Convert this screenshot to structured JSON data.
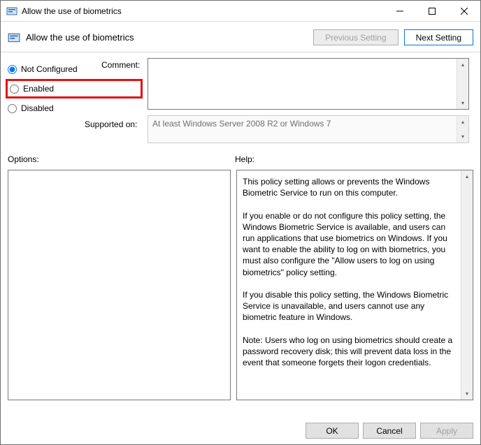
{
  "window": {
    "title": "Allow the use of biometrics"
  },
  "header": {
    "title": "Allow the use of biometrics",
    "prev_label": "Previous Setting",
    "next_label": "Next Setting"
  },
  "state": {
    "not_configured_label": "Not Configured",
    "enabled_label": "Enabled",
    "disabled_label": "Disabled",
    "selected": "not_configured"
  },
  "comment": {
    "label": "Comment:",
    "value": ""
  },
  "supported": {
    "label": "Supported on:",
    "value": "At least Windows Server 2008 R2 or Windows 7"
  },
  "lower": {
    "options_label": "Options:",
    "help_label": "Help:"
  },
  "help": {
    "text": "This policy setting allows or prevents the Windows Biometric Service to run on this computer.\n\nIf you enable or do not configure this policy setting, the Windows Biometric Service is available, and users can run applications that use biometrics on Windows. If you want to enable the ability to log on with biometrics, you must also configure the \"Allow users to log on using biometrics\" policy setting.\n\nIf you disable this policy setting, the Windows Biometric Service is unavailable, and users cannot use any biometric feature in Windows.\n\nNote: Users who log on using biometrics should create a password recovery disk; this will prevent data loss in the event that someone forgets their logon credentials."
  },
  "footer": {
    "ok": "OK",
    "cancel": "Cancel",
    "apply": "Apply"
  }
}
